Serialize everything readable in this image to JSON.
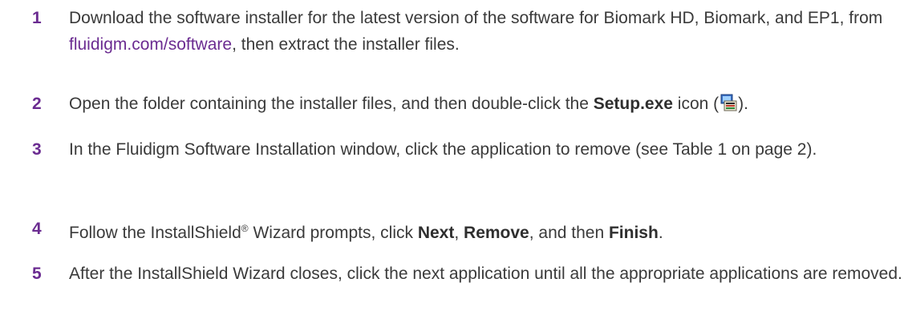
{
  "steps": [
    {
      "number": "1",
      "text_before": "Download the software installer for the latest version of the software for Biomark HD, Biomark, and EP1, from ",
      "link": "fluidigm.com/software",
      "text_after": ", then extract the installer files."
    },
    {
      "number": "2",
      "text_before": "Open the folder containing the installer files, and then double-click the ",
      "bold": "Setup.exe",
      "text_after": " icon (",
      "icon": "setup-exe-icon",
      "text_end": ")."
    },
    {
      "number": "3",
      "text": "In the Fluidigm Software Installation window, click the application to remove (see Table 1 on page 2)."
    },
    {
      "number": "4",
      "text_before": "Follow the InstallShield",
      "registered": "®",
      "text_mid": " Wizard prompts, click ",
      "bold1": "Next",
      "sep1": ", ",
      "bold2": "Remove",
      "sep2": ", and then ",
      "bold3": "Finish",
      "text_end": "."
    },
    {
      "number": "5",
      "text": "After the InstallShield Wizard closes, click the next application until all the appropriate applications are removed."
    }
  ],
  "colors": {
    "accent": "#6b2c91",
    "text": "#3a3a3a"
  }
}
